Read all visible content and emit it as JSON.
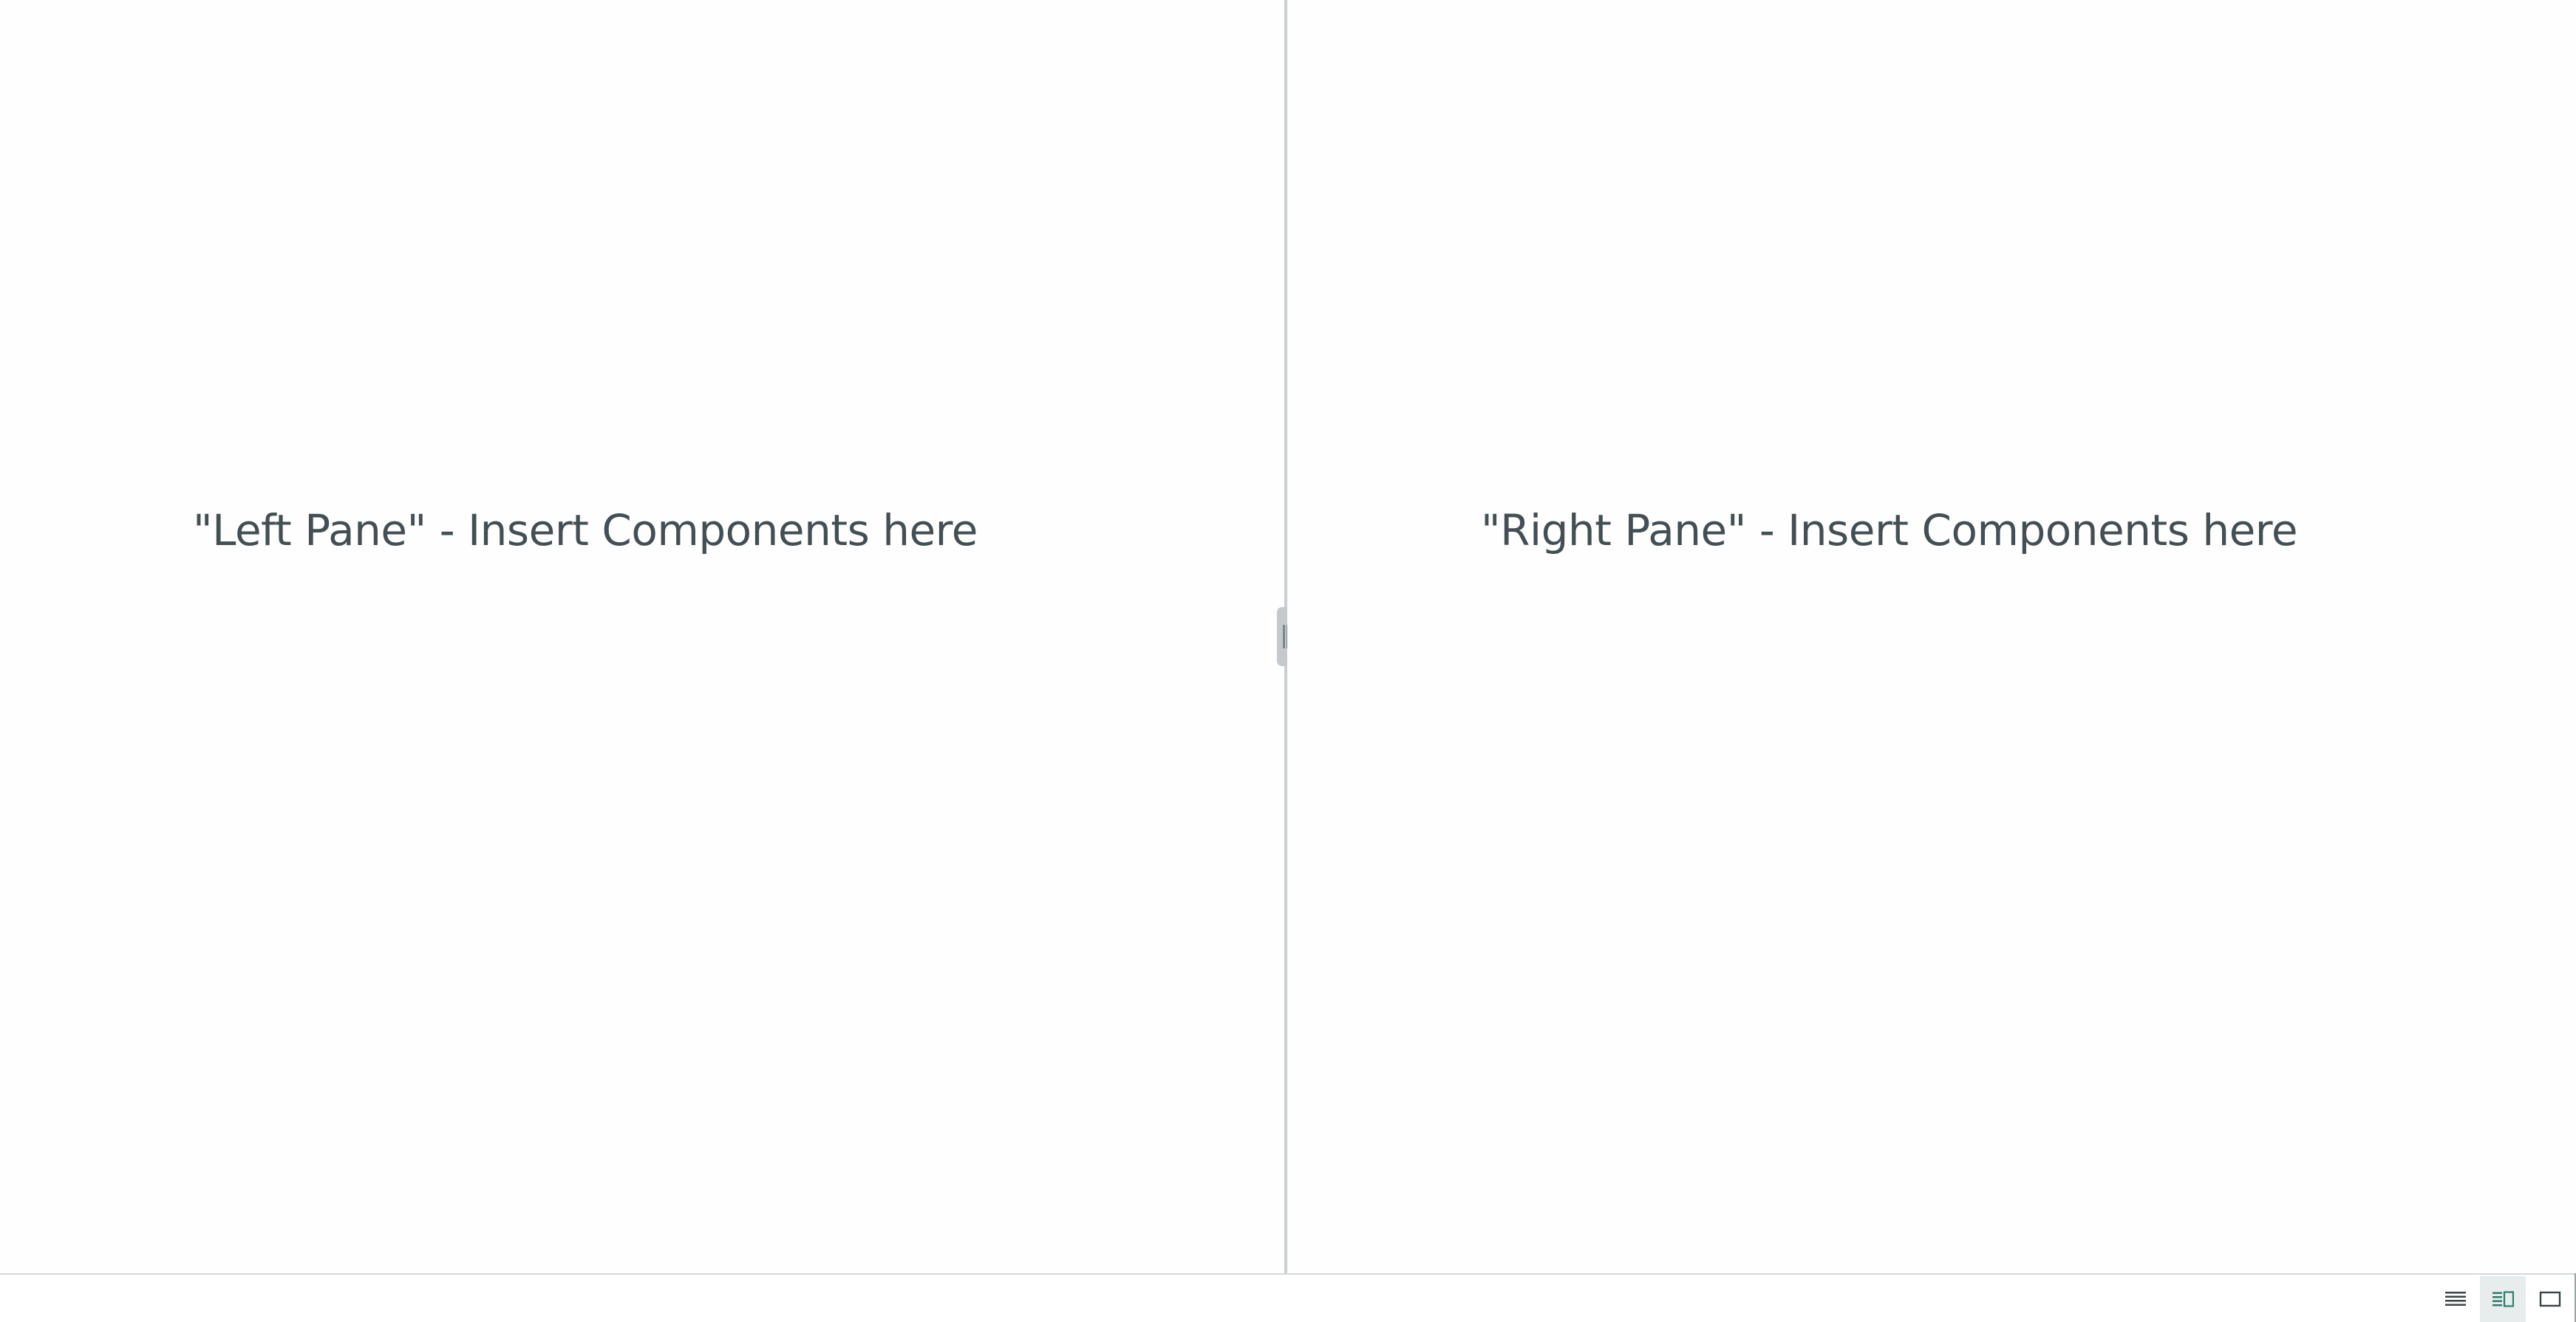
{
  "panes": {
    "left": {
      "placeholder": "\"Left Pane\" - Insert Components here"
    },
    "right": {
      "placeholder": "\"Right Pane\" - Insert Components here"
    }
  },
  "status_bar": {
    "layout_buttons": [
      {
        "icon": "list-layout-icon",
        "selected": false
      },
      {
        "icon": "split-layout-icon",
        "selected": true
      },
      {
        "icon": "single-pane-layout-icon",
        "selected": false
      }
    ]
  },
  "colors": {
    "text": "#434f54",
    "divider": "#c9cfd1",
    "selected_button_bg": "#e7eced",
    "split_icon_accent": "#2e7d6b"
  }
}
